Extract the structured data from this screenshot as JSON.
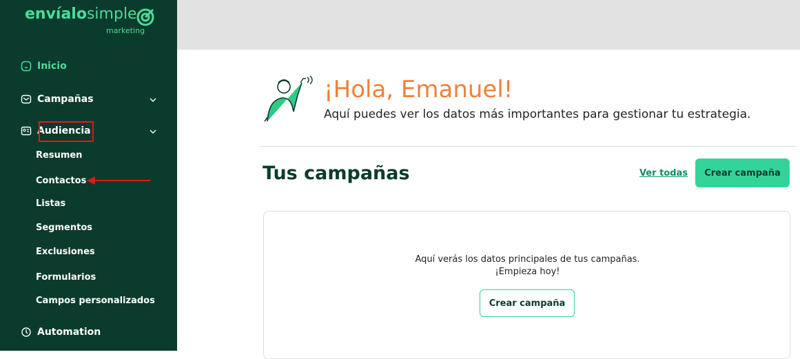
{
  "brand": {
    "name_bold": "envíalo",
    "name_rest": "simple",
    "tagline": "marketing",
    "accent": "#4cdc9a",
    "sidebar_bg": "#0b3b2c"
  },
  "sidebar": {
    "items": [
      {
        "label": "Inicio",
        "icon": "home-icon"
      },
      {
        "label": "Campañas",
        "icon": "mail-icon"
      },
      {
        "label": "Audiencia",
        "icon": "contact-card-icon"
      },
      {
        "label": "Automation",
        "icon": "automation-clock-icon"
      }
    ],
    "audiencia_sub": [
      "Resumen",
      "Contactos",
      "Listas",
      "Segmentos",
      "Exclusiones",
      "Formularios",
      "Campos personalizados"
    ]
  },
  "greeting": {
    "title": "¡Hola, Emanuel!",
    "subtitle": "Aquí puedes ver los datos más importantes para gestionar tu estrategia."
  },
  "campaigns": {
    "title": "Tus campañas",
    "view_all": "Ver todas",
    "create_button": "Crear campaña",
    "empty_line1": "Aquí verás los datos principales de tus campañas.",
    "empty_line2": "¡Empieza hoy!",
    "empty_button": "Crear campaña"
  },
  "colors": {
    "primary_button": "#33d49a",
    "greeting_title": "#f0813a",
    "annotation_red": "#e0191b"
  }
}
